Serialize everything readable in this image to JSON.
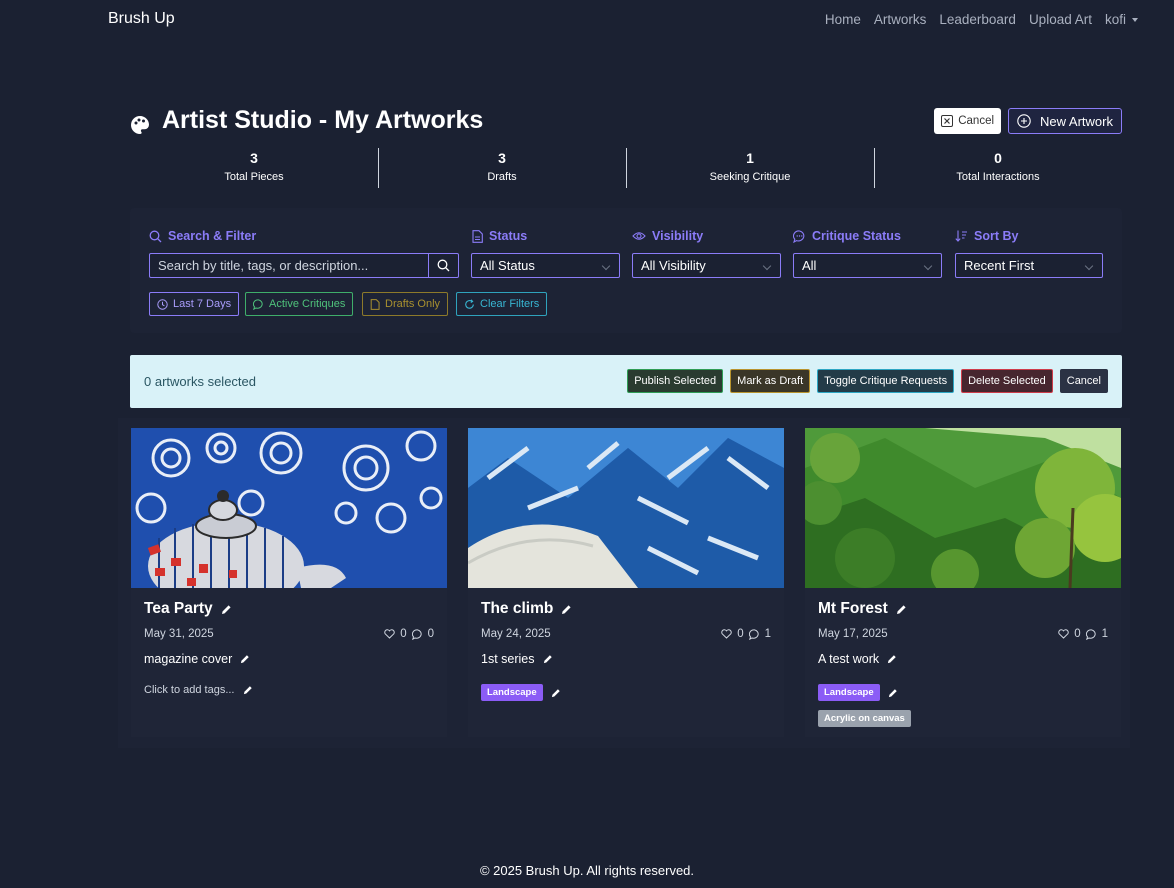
{
  "nav": {
    "brand": "Brush Up",
    "links": [
      "Home",
      "Artworks",
      "Leaderboard",
      "Upload Art"
    ],
    "user": "kofi"
  },
  "header": {
    "title": "Artist Studio - My Artworks",
    "cancel_label": "Cancel",
    "new_label": "New Artwork"
  },
  "stats": [
    {
      "value": "3",
      "label": "Total Pieces"
    },
    {
      "value": "3",
      "label": "Drafts"
    },
    {
      "value": "1",
      "label": "Seeking Critique"
    },
    {
      "value": "0",
      "label": "Total Interactions"
    }
  ],
  "filters": {
    "search_label": "Search & Filter",
    "search_placeholder": "Search by title, tags, or description...",
    "status_label": "Status",
    "status_value": "All Status",
    "visibility_label": "Visibility",
    "visibility_value": "All Visibility",
    "critique_label": "Critique Status",
    "critique_value": "All",
    "sort_label": "Sort By",
    "sort_value": "Recent First",
    "quick": [
      "Last 7 Days",
      "Active Critiques",
      "Drafts Only",
      "Clear Filters"
    ]
  },
  "bulk": {
    "count_text": "0 artworks selected",
    "actions": [
      "Publish Selected",
      "Mark as Draft",
      "Toggle Critique Requests",
      "Delete Selected",
      "Cancel"
    ]
  },
  "artworks": [
    {
      "title": "Tea Party",
      "date": "May 31, 2025",
      "likes": "0",
      "comments": "0",
      "description": "magazine cover",
      "tags_prompt": "Click to add tags...",
      "tags": []
    },
    {
      "title": "The climb",
      "date": "May 24, 2025",
      "likes": "0",
      "comments": "1",
      "description": "1st series",
      "tags": [
        "Landscape"
      ]
    },
    {
      "title": "Mt Forest",
      "date": "May 17, 2025",
      "likes": "0",
      "comments": "1",
      "description": "A test work",
      "tags": [
        "Landscape",
        "Acrylic on canvas"
      ]
    }
  ],
  "footer": "© 2025 Brush Up. All rights reserved.",
  "colors": {
    "accent": "#8b7cf8",
    "background": "#1b2132",
    "bulk_bar": "#d9f2f8"
  }
}
